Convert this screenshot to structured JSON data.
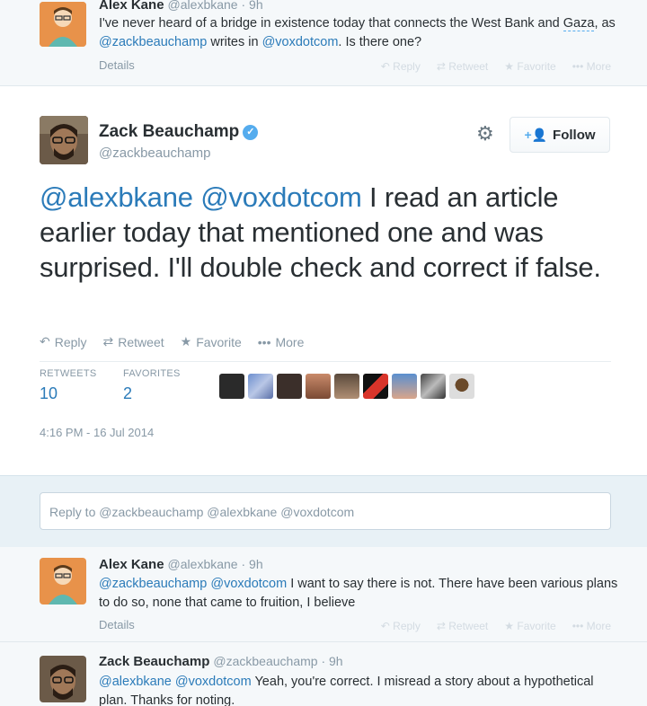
{
  "top_tweet": {
    "name": "Alex Kane",
    "handle": "@alexbkane · 9h",
    "text_a": "I've never heard of a bridge in existence today that connects the West Bank and ",
    "text_gaza": "Gaza",
    "text_b": ", as ",
    "mention1": "@zackbeauchamp",
    "text_c": " writes in ",
    "mention2": "@voxdotcom",
    "text_d": ". Is there one?",
    "details": "Details",
    "actions": [
      "Reply",
      "Retweet",
      "Favorite",
      "More"
    ]
  },
  "main_tweet": {
    "fullname": "Zack Beauchamp",
    "screenname": "@zackbeauchamp",
    "follow_label": "Follow",
    "mention1": "@alexbkane",
    "mention2": "@voxdotcom",
    "text": " I read an article earlier today that mentioned one and was surprised. I'll double check and correct if false.",
    "actions": [
      "Reply",
      "Retweet",
      "Favorite",
      "More"
    ],
    "retweets_label": "RETWEETS",
    "retweets_count": "10",
    "favorites_label": "FAVORITES",
    "favorites_count": "2",
    "timestamp": "4:16 PM - 16 Jul 2014"
  },
  "reply_box": {
    "text": "Reply to @zackbeauchamp @alexbkane @voxdotcom"
  },
  "reply1": {
    "name": "Alex Kane",
    "handle": "@alexbkane · 9h",
    "mention1": "@zackbeauchamp",
    "mention2": "@voxdotcom",
    "text": " I want to say there is not. There have been various plans to do so, none that came to fruition, I believe",
    "details": "Details",
    "actions": [
      "Reply",
      "Retweet",
      "Favorite",
      "More"
    ]
  },
  "reply2": {
    "name": "Zack Beauchamp",
    "handle": "@zackbeauchamp · 9h",
    "mention1": "@alexbkane",
    "mention2": "@voxdotcom",
    "text": " Yeah, you're correct. I misread a story about a hypothetical plan. Thanks for noting."
  },
  "colors": {
    "link": "#2b7bb9",
    "verified": "#55acee",
    "muted": "#8899a6"
  },
  "icons": [
    "reply-icon",
    "retweet-icon",
    "favorite-star-icon",
    "more-dots-icon",
    "gear-icon",
    "add-user-icon",
    "verified-badge-icon"
  ]
}
